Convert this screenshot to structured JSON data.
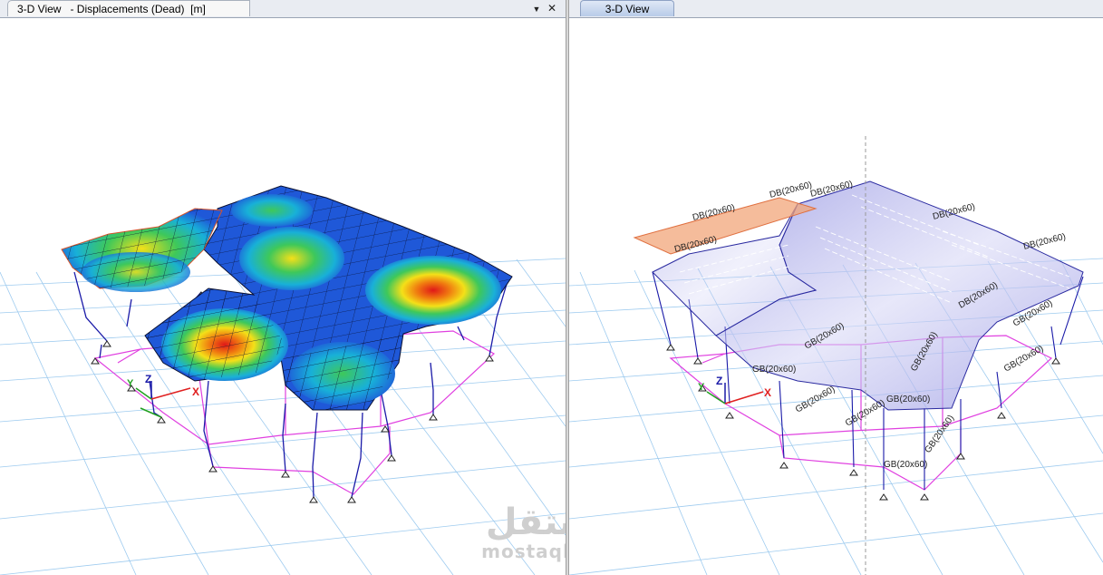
{
  "left_window": {
    "tab_title": "3-D View   - Displacements (Dead)  [m]",
    "pin_icon": "pin-icon",
    "pin_label": "▼",
    "close_icon": "close-icon",
    "close_label": "✕",
    "axes": {
      "x": "X",
      "y": "Y",
      "z": "Z"
    }
  },
  "right_window": {
    "tab_title": "3-D View",
    "axes": {
      "x": "X",
      "y": "Y",
      "z": "Z"
    },
    "beam_labels": [
      "DB(20x60)",
      "DB(20x60)",
      "DB(20x60)",
      "DB(20x60)",
      "DB(20x60)",
      "DB(20x60)",
      "DB(20x60)",
      "GB(20x60)",
      "GB(20x60)",
      "GB(20x60)",
      "GB(20x60)",
      "GB(20x60)",
      "GB(20x60)",
      "GB(20x60)",
      "GB(20x60)",
      "GB(20x60)",
      "GB(20x60)"
    ]
  },
  "watermark": {
    "arabic": "مستقل",
    "latin": "mostaql.com"
  },
  "colors": {
    "grid": "#9ecbef",
    "frame_column": "#1a1aa8",
    "frame_beam": "#e040e0",
    "tab_active": "#c6d6ee",
    "slab_shade": "#8f8fe0",
    "highlight_slab": "#f2a57a",
    "contour_low": "#1f58d8",
    "contour_high": "#e82020"
  }
}
